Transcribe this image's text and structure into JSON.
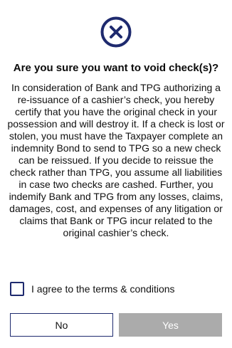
{
  "dialog": {
    "icon": "close-circle-icon",
    "accent_color": "#1e2a6e",
    "title": "Are you sure you want to void check(s)?",
    "body": "In consideration of Bank and TPG authorizing a re-issuance of a cashier’s check, you hereby certify that you have the original check in your possession and will destroy it. If a check is lost or stolen, you must have the Taxpayer complete an indemnity Bond to send to TPG so a new check can be reissued. If you decide to reissue the check rather than TPG, you assume all liabilities in case two checks are cashed. Further, you indemify Bank and TPG from any losses, claims, damages, cost, and expenses of any litigation or claims that Bank or TPG incur related to the original cashier’s check.",
    "agree_label": "I agree to the terms & conditions",
    "agree_checked": false,
    "no_label": "No",
    "yes_label": "Yes",
    "yes_disabled_color": "#ababab"
  }
}
